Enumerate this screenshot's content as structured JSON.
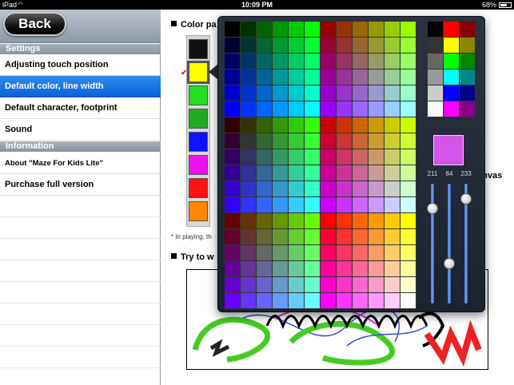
{
  "status": {
    "carrier": "iPad",
    "time": "10:09 PM",
    "battery": "68%",
    "battery_level": 0.68
  },
  "nav": {
    "back_label": "Back"
  },
  "sections": [
    {
      "title": "Settings",
      "items": [
        {
          "label": "Adjusting touch position",
          "selected": false
        },
        {
          "label": "Default color, line width",
          "selected": true
        },
        {
          "label": "Default character, footprint",
          "selected": false
        },
        {
          "label": "Sound",
          "selected": false
        }
      ]
    },
    {
      "title": "Information",
      "items": [
        {
          "label": "About \"Maze For Kids Lite\"",
          "selected": false
        },
        {
          "label": "Purchase full version",
          "selected": false
        }
      ]
    }
  ],
  "main": {
    "color_heading": "Color pa",
    "note": "* In playing, th",
    "try_heading": "Try to w",
    "canvas_label": "anvas",
    "palette_colors": [
      "#111111",
      "#ffff00",
      "#22dd22",
      "#22aa22",
      "#1111ff",
      "#ee11ee",
      "#ff1111",
      "#ff8800"
    ],
    "selected_palette_index": 1
  },
  "picker": {
    "mini_colors": [
      "#000000",
      "#ff0000",
      "#880000",
      "#333333",
      "#ffff00",
      "#888800",
      "#666666",
      "#00ff00",
      "#008800",
      "#999999",
      "#00ffff",
      "#008888",
      "#cccccc",
      "#0000ff",
      "#000088",
      "#ffffff",
      "#ff00ff",
      "#880088"
    ],
    "preview_color": "#d454e9",
    "rgb": {
      "r": 211,
      "g": 84,
      "b": 233
    }
  }
}
